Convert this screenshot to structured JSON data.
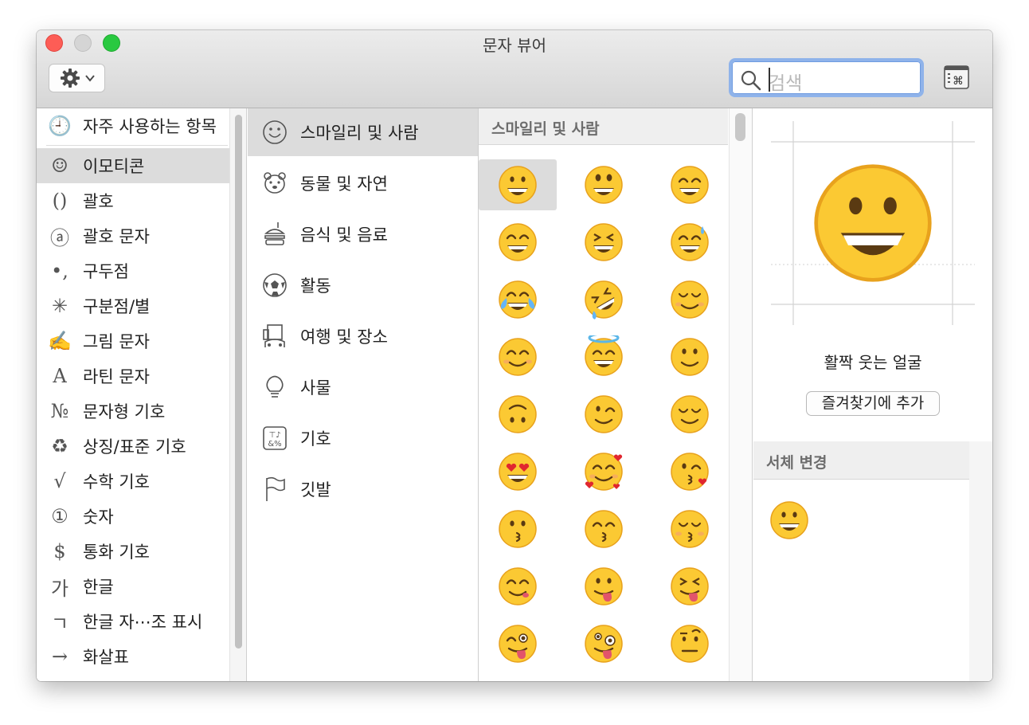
{
  "window": {
    "title": "문자 뷰어"
  },
  "toolbar": {
    "gear_icon": "gear-icon",
    "search": {
      "placeholder": "검색",
      "value": ""
    },
    "keyboard_viewer_icon": "keyboard-viewer-icon"
  },
  "sidebar": {
    "items": [
      {
        "icon": "🕘",
        "label": "자주 사용하는 항목"
      },
      {
        "icon": "☺",
        "label": "이모티콘",
        "selected": true
      },
      {
        "icon": "()",
        "label": "괄호"
      },
      {
        "icon": "ⓐ",
        "label": "괄호 문자"
      },
      {
        "icon": "•,",
        "label": "구두점"
      },
      {
        "icon": "✳",
        "label": "구분점/별"
      },
      {
        "icon": "✍",
        "label": "그림 문자"
      },
      {
        "icon": "A",
        "label": "라틴 문자"
      },
      {
        "icon": "№",
        "label": "문자형 기호"
      },
      {
        "icon": "♻",
        "label": "상징/표준 기호"
      },
      {
        "icon": "√",
        "label": "수학 기호"
      },
      {
        "icon": "①",
        "label": "숫자"
      },
      {
        "icon": "$",
        "label": "통화 기호"
      },
      {
        "icon": "가",
        "label": "한글"
      },
      {
        "icon": "ㄱ",
        "label": "한글 자⋯조 표시"
      },
      {
        "icon": "→",
        "label": "화살표"
      }
    ]
  },
  "categories": [
    {
      "icon": "smiley-category-icon",
      "label": "스마일리 및 사람",
      "selected": true
    },
    {
      "icon": "bear-category-icon",
      "label": "동물 및 자연"
    },
    {
      "icon": "food-category-icon",
      "label": "음식 및 음료"
    },
    {
      "icon": "soccer-ball-category-icon",
      "label": "활동"
    },
    {
      "icon": "building-car-category-icon",
      "label": "여행 및 장소"
    },
    {
      "icon": "lightbulb-category-icon",
      "label": "사물"
    },
    {
      "icon": "symbols-category-icon",
      "label": "기호"
    },
    {
      "icon": "flag-category-icon",
      "label": "깃발"
    }
  ],
  "grid": {
    "header": "스마일리 및 사람",
    "emojis": [
      "grinning",
      "smiley",
      "smile",
      "grin",
      "laughing",
      "sweat_smile",
      "joy",
      "rofl",
      "relaxed",
      "blush",
      "innocent",
      "slight_smile",
      "upside_down",
      "wink",
      "relieved",
      "heart_eyes",
      "smiling_hearts",
      "kissing_heart",
      "kissing",
      "kissing_smiling_eyes",
      "kissing_closed_eyes",
      "yum",
      "tongue",
      "squinting_tongue",
      "winking_tongue",
      "zany",
      "raised_eyebrow"
    ]
  },
  "detail": {
    "name": "활짝 웃는 얼굴",
    "favorite_button": "즐겨찾기에 추가",
    "font_variation_header": "서체 변경"
  },
  "colors": {
    "close": "#fd5d56",
    "minimize": "#d5d5d5",
    "maximize": "#29c940",
    "search_focus": "#8fb3ea",
    "emoji_face": "#fbc933",
    "emoji_outline": "#e8a21d",
    "selection": "#dcdcdc"
  }
}
